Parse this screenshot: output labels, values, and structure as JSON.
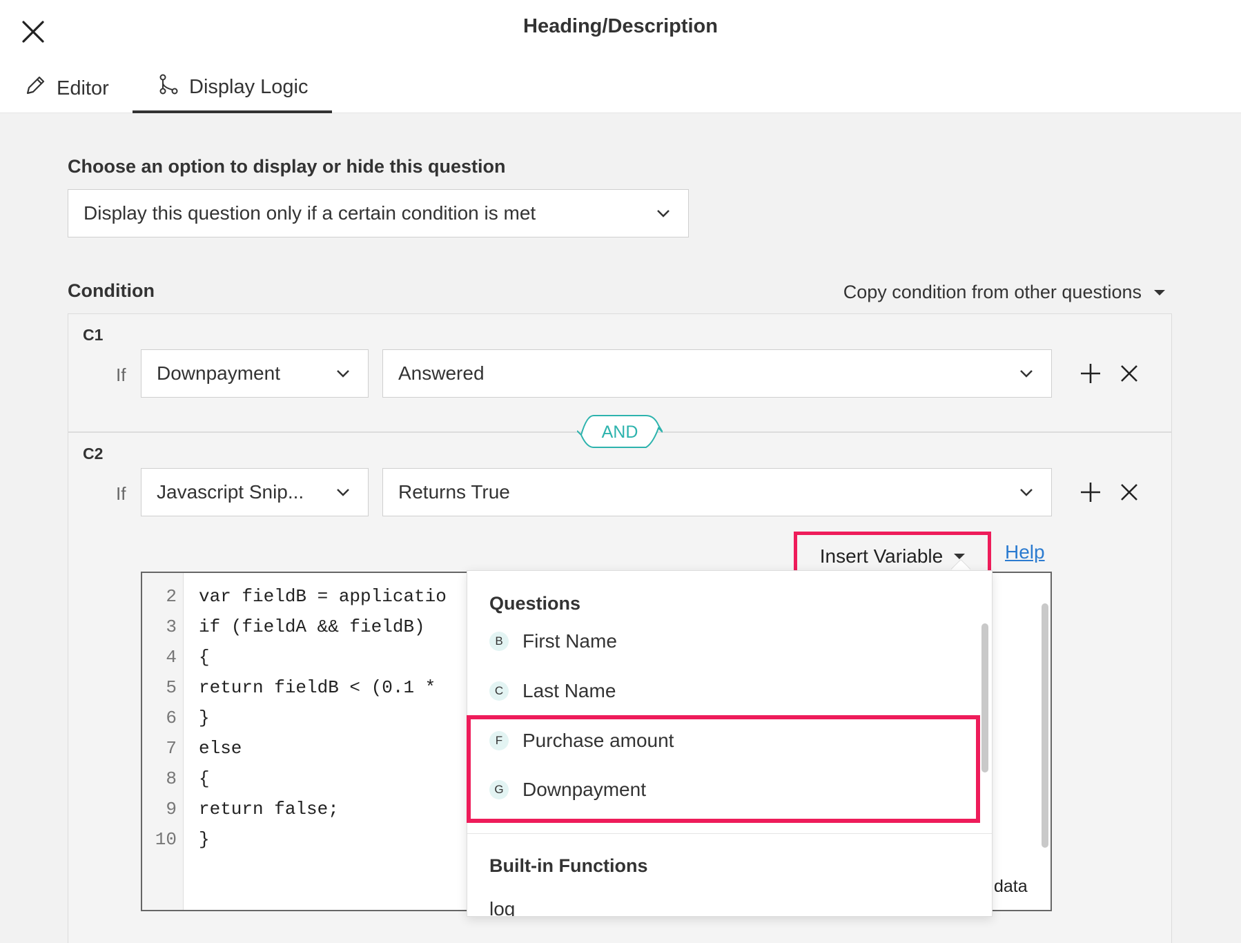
{
  "header": {
    "title": "Heading/Description",
    "tabs": [
      {
        "label": "Editor",
        "icon": "pencil-icon"
      },
      {
        "label": "Display Logic",
        "icon": "branch-icon"
      }
    ]
  },
  "display_option": {
    "label": "Choose an option to display or hide this question",
    "value": "Display this question only if a certain condition is met"
  },
  "condition": {
    "label": "Condition",
    "copy_label": "Copy condition from other questions",
    "join_operator": "AND",
    "rows": [
      {
        "id": "C1",
        "if_label": "If",
        "field": "Downpayment",
        "operator": "Answered"
      },
      {
        "id": "C2",
        "if_label": "If",
        "field": "Javascript Snip...",
        "operator": "Returns True"
      }
    ]
  },
  "editor": {
    "insert_variable_label": "Insert Variable",
    "help_label": "Help",
    "lines": [
      {
        "n": "2",
        "code": "var fieldB = applicatio"
      },
      {
        "n": "3",
        "code": "if (fieldA && fieldB)"
      },
      {
        "n": "4",
        "code": "{"
      },
      {
        "n": "5",
        "code": "return fieldB < (0.1 *"
      },
      {
        "n": "6",
        "code": "}"
      },
      {
        "n": "7",
        "code": "else"
      },
      {
        "n": "8",
        "code": "{"
      },
      {
        "n": "9",
        "code": "return false;"
      },
      {
        "n": "10",
        "code": "}"
      }
    ],
    "trailing_text": "data"
  },
  "variable_menu": {
    "questions_heading": "Questions",
    "questions": [
      {
        "badge": "B",
        "label": "First Name"
      },
      {
        "badge": "C",
        "label": "Last Name"
      },
      {
        "badge": "F",
        "label": "Purchase amount"
      },
      {
        "badge": "G",
        "label": "Downpayment"
      }
    ],
    "functions_heading": "Built-in Functions",
    "functions": [
      "log"
    ]
  },
  "colors": {
    "highlight": "#ee1c5a",
    "and_accent": "#2db3ad",
    "link": "#2b7bd0"
  }
}
